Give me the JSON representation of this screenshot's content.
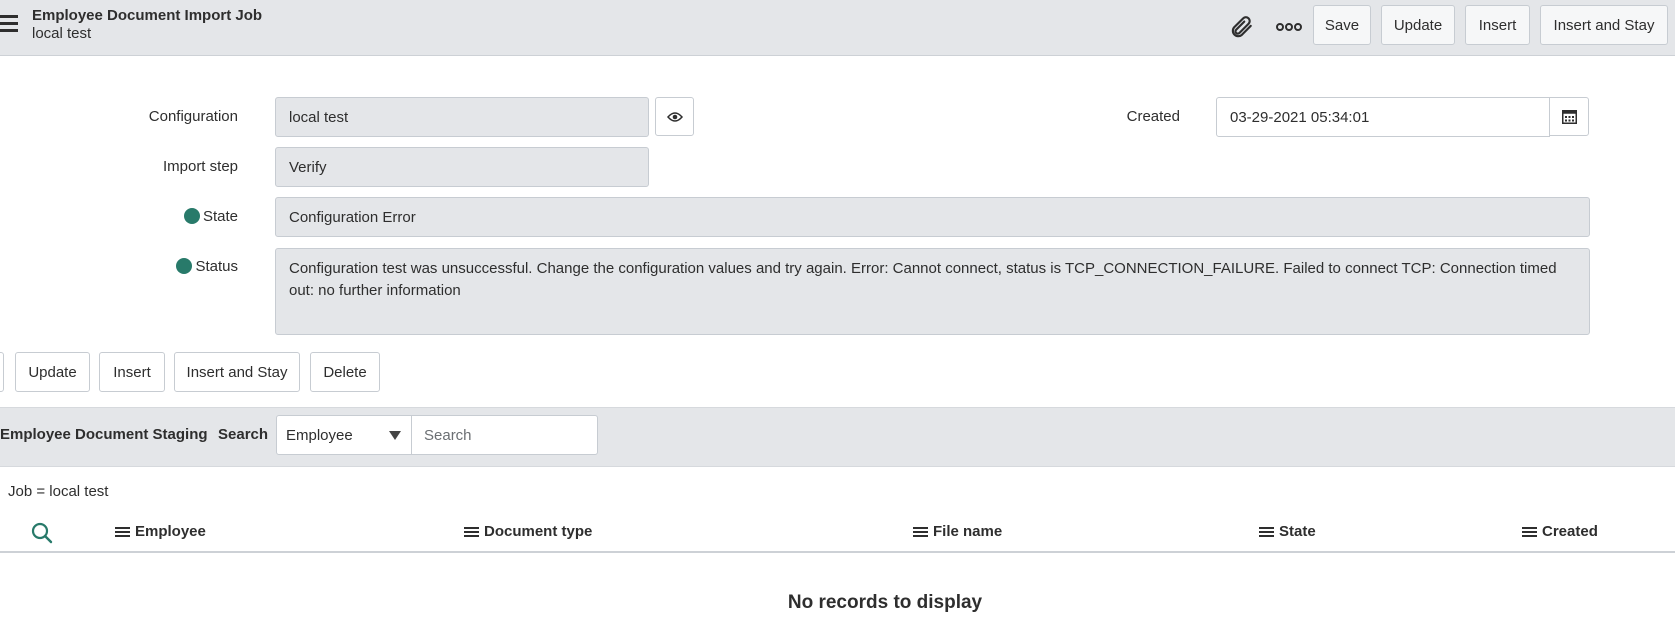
{
  "header": {
    "title": "Employee Document Import Job",
    "subtitle": "local test",
    "icons": [
      "hamburger-menu-icon",
      "paperclip-icon",
      "more-options-icon"
    ],
    "buttons": {
      "save": "Save",
      "update": "Update",
      "insert": "Insert",
      "insert_and_stay": "Insert and Stay"
    }
  },
  "form": {
    "configuration": {
      "label": "Configuration",
      "value": "local test"
    },
    "import_step": {
      "label": "Import step",
      "value": "Verify"
    },
    "state": {
      "label": "State",
      "value": "Configuration Error"
    },
    "status": {
      "label": "Status",
      "value": "Configuration test was unsuccessful. Change the configuration values and try again. Error: Cannot connect, status is TCP_CONNECTION_FAILURE. Failed to connect TCP: Connection timed out: no further information"
    },
    "created": {
      "label": "Created",
      "value": "03-29-2021 05:34:01"
    }
  },
  "form_buttons": {
    "update": "Update",
    "insert": "Insert",
    "insert_and_stay": "Insert and Stay",
    "delete": "Delete"
  },
  "related_list": {
    "title": "Employee Document Staging",
    "search_label": "Search",
    "search_field": "Employee",
    "search_placeholder": "Search",
    "filter": "Job = local test",
    "columns": [
      "Employee",
      "Document type",
      "File name",
      "State",
      "Created"
    ],
    "empty_message": "No records to display"
  },
  "colors": {
    "header_bg": "#e4e6e9",
    "readonly_field_bg": "#e4e6e9",
    "status_icon": "#287a6a",
    "search_icon": "#287a6a"
  }
}
